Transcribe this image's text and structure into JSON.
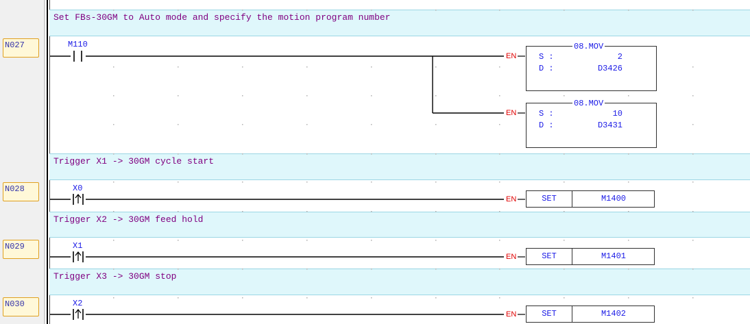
{
  "rungs": [
    {
      "label": "N027",
      "comment": "Set FBs-30GM to Auto mode and specify the motion program number",
      "contact": "M110",
      "blocks": [
        {
          "title": "08.MOV",
          "s_label": "S :",
          "s_value": "2",
          "d_label": "D :",
          "d_value": "D3426",
          "en": "EN"
        },
        {
          "title": "08.MOV",
          "s_label": "S :",
          "s_value": "10",
          "d_label": "D :",
          "d_value": "D3431",
          "en": "EN"
        }
      ]
    },
    {
      "label": "N028",
      "comment": "Trigger X1 -> 30GM cycle start",
      "contact": "X0",
      "en": "EN",
      "instruction": "SET",
      "operand": "M1400"
    },
    {
      "label": "N029",
      "comment": "Trigger X2 -> 30GM feed hold",
      "contact": "X1",
      "en": "EN",
      "instruction": "SET",
      "operand": "M1401"
    },
    {
      "label": "N030",
      "comment": "Trigger X3 -> 30GM stop",
      "contact": "X2",
      "en": "EN",
      "instruction": "SET",
      "operand": "M1402"
    }
  ],
  "colors": {
    "comment_bg": "#dff7fb",
    "comment_text": "#800080",
    "operand_text": "#1a1ae6",
    "en_text": "#e00000",
    "rung_label_bg": "#fff8d8",
    "rung_label_border": "#e0a020"
  }
}
